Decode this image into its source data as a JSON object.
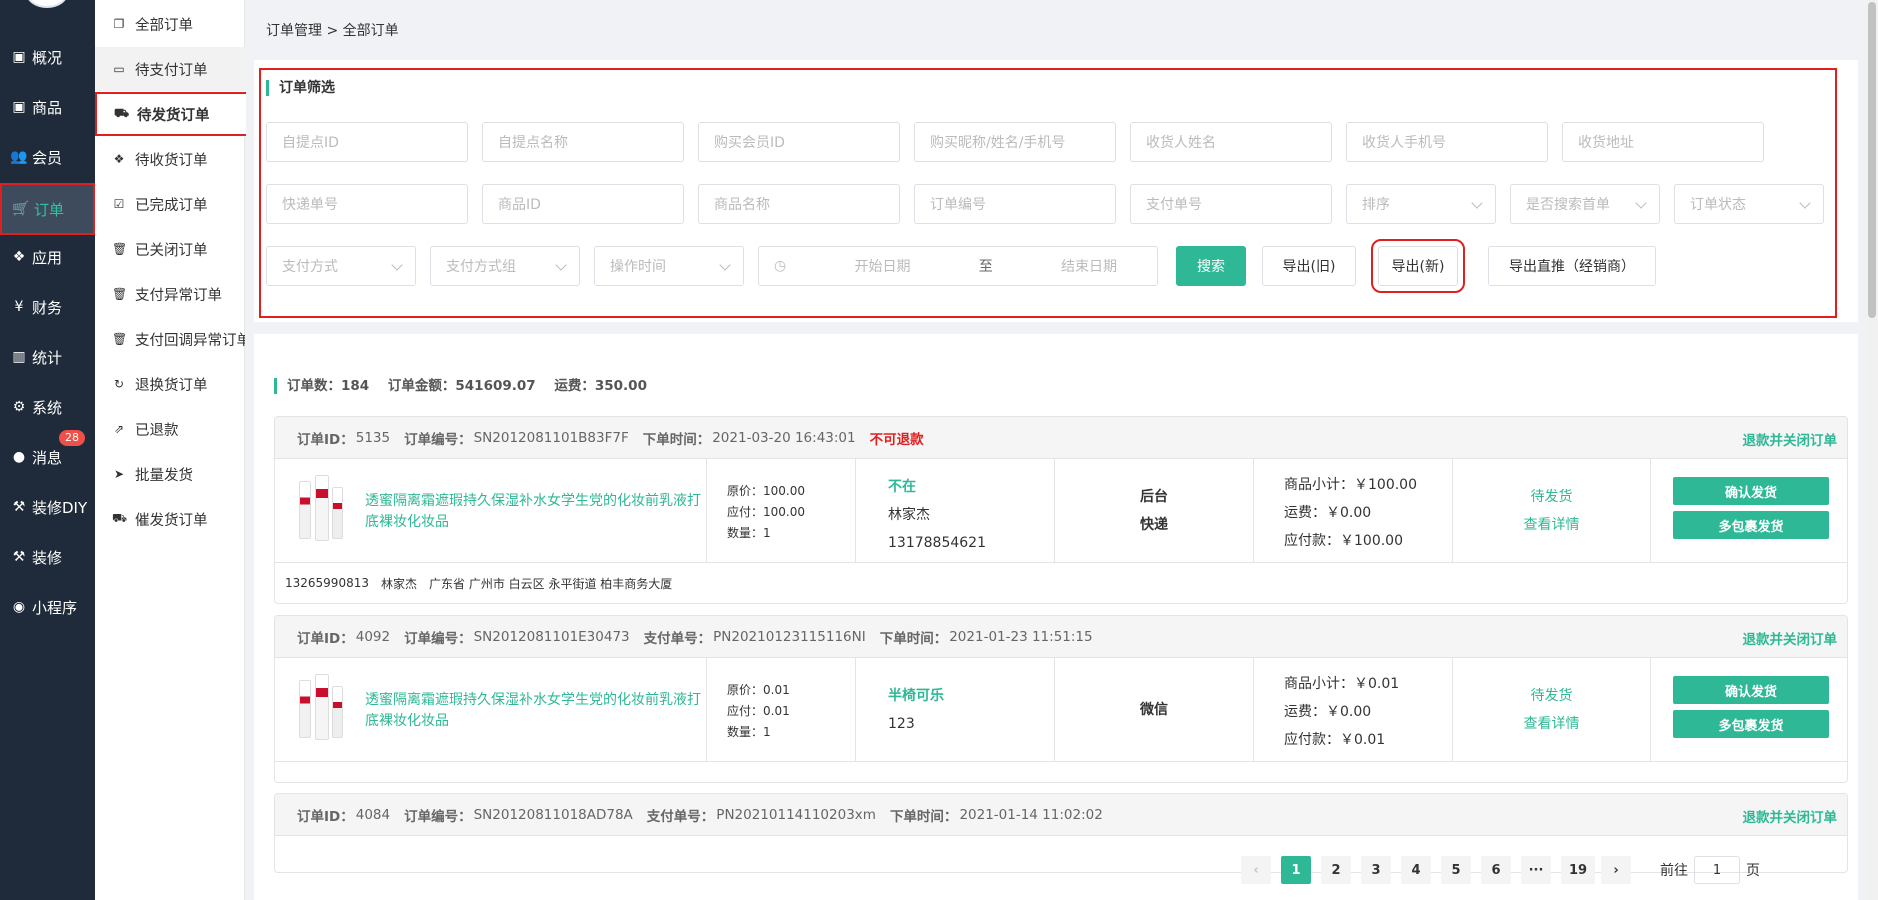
{
  "nav": {
    "items": [
      {
        "icon": "overview-icon",
        "glyph": "▣",
        "label": "概况"
      },
      {
        "icon": "goods-icon",
        "glyph": "▣",
        "label": "商品"
      },
      {
        "icon": "members-icon",
        "glyph": "👥",
        "label": "会员"
      },
      {
        "icon": "cart-icon",
        "glyph": "🛒",
        "label": "订单"
      },
      {
        "icon": "apps-icon",
        "glyph": "❖",
        "label": "应用"
      },
      {
        "icon": "yen-icon",
        "glyph": "¥",
        "label": "财务"
      },
      {
        "icon": "chart-icon",
        "glyph": "▥",
        "label": "统计"
      },
      {
        "icon": "gears-icon",
        "glyph": "⚙",
        "label": "系统"
      },
      {
        "icon": "message-icon",
        "glyph": "●",
        "label": "消息",
        "badge": "28"
      },
      {
        "icon": "hammer-icon",
        "glyph": "⚒",
        "label": "装修DIY"
      },
      {
        "icon": "hammer-icon",
        "glyph": "⚒",
        "label": "装修"
      },
      {
        "icon": "wechat-icon",
        "glyph": "◉",
        "label": "小程序"
      }
    ]
  },
  "subnav": {
    "items": [
      {
        "icon": "copy-icon",
        "glyph": "❐",
        "label": "全部订单"
      },
      {
        "icon": "card-icon",
        "glyph": "▭",
        "label": "待支付订单"
      },
      {
        "icon": "truck-icon",
        "glyph": "⛟",
        "label": "待发货订单"
      },
      {
        "icon": "dropbox-icon",
        "glyph": "❖",
        "label": "待收货订单"
      },
      {
        "icon": "check-square-icon",
        "glyph": "☑",
        "label": "已完成订单"
      },
      {
        "icon": "trash-icon",
        "glyph": "🗑",
        "label": "已关闭订单"
      },
      {
        "icon": "trash-icon",
        "glyph": "🗑",
        "label": "支付异常订单"
      },
      {
        "icon": "trash-icon",
        "glyph": "🗑",
        "label": "支付回调异常订单"
      },
      {
        "icon": "refresh-icon",
        "glyph": "↻",
        "label": "退换货订单"
      },
      {
        "icon": "share-icon",
        "glyph": "⇗",
        "label": "已退款"
      },
      {
        "icon": "paper-plane-icon",
        "glyph": "➤",
        "label": "批量发货"
      },
      {
        "icon": "truck-icon",
        "glyph": "⛟",
        "label": "催发货订单"
      }
    ]
  },
  "breadcrumb": "订单管理 > 全部订单",
  "filter": {
    "title": "订单筛选",
    "row1": [
      "自提点ID",
      "自提点名称",
      "购买会员ID",
      "购买昵称/姓名/手机号",
      "收货人姓名",
      "收货人手机号",
      "收货地址"
    ],
    "row2_inputs": [
      "快递单号",
      "商品ID",
      "商品名称",
      "订单编号",
      "支付单号"
    ],
    "row2_selects": [
      "排序",
      "是否搜索首单",
      "订单状态"
    ],
    "row3_selects": [
      "支付方式",
      "支付方式组",
      "操作时间"
    ],
    "date_start": "开始日期",
    "date_sep": "至",
    "date_end": "结束日期",
    "btn_search": "搜索",
    "btn_export_old": "导出(旧)",
    "btn_export_new": "导出(新)",
    "btn_export_direct": "导出直推（经销商）"
  },
  "summary": {
    "count_label": "订单数：",
    "count": "184",
    "amount_label": "订单金额：",
    "amount": "541609.07",
    "freight_label": "运费：",
    "freight": "350.00"
  },
  "orders": [
    {
      "id_label": "订单ID：",
      "id": "5135",
      "sn_label": "订单编号：",
      "sn": "SN2012081101B83F7F",
      "pay_label": "",
      "pay_sn": "",
      "time_label": "下单时间：",
      "time": "2021-03-20 16:43:01",
      "warn": "不可退款",
      "close": "退款并关闭订单",
      "product": "透蜜隔离霜遮瑕持久保湿补水女学生党的化妆前乳液打底裸妆化妆品",
      "orig_price": "原价：100.00",
      "pay_price": "应付：100.00",
      "qty": "数量：1",
      "buyer_nick": "不在",
      "buyer_name": "林家杰",
      "buyer_phone": "13178854621",
      "ship1": "后台",
      "ship2": "快递",
      "subtotal": "商品小计：￥100.00",
      "freight": "运费：￥0.00",
      "payable": "应付款：￥100.00",
      "status": "待发货",
      "detail": "查看详情",
      "btn_ship": "确认发货",
      "btn_multi": "多包裹发货",
      "addr_phone": "13265990813",
      "addr_name": "林家杰",
      "addr": "广东省 广州市 白云区 永平街道 柏丰商务大厦"
    },
    {
      "id_label": "订单ID：",
      "id": "4092",
      "sn_label": "订单编号：",
      "sn": "SN2012081101E30473",
      "pay_label": "支付单号：",
      "pay_sn": "PN20210123115116NI",
      "time_label": "下单时间：",
      "time": "2021-01-23 11:51:15",
      "warn": "",
      "close": "退款并关闭订单",
      "product": "透蜜隔离霜遮瑕持久保湿补水女学生党的化妆前乳液打底裸妆化妆品",
      "orig_price": "原价：0.01",
      "pay_price": "应付：0.01",
      "qty": "数量：1",
      "buyer_nick": "半椅可乐",
      "buyer_name": "123",
      "buyer_phone": "",
      "ship1": "微信",
      "ship2": "",
      "subtotal": "商品小计：￥0.01",
      "freight": "运费：￥0.00",
      "payable": "应付款：￥0.01",
      "status": "待发货",
      "detail": "查看详情",
      "btn_ship": "确认发货",
      "btn_multi": "多包裹发货",
      "addr_phone": "",
      "addr_name": "",
      "addr": ""
    },
    {
      "id_label": "订单ID：",
      "id": "4084",
      "sn_label": "订单编号：",
      "sn": "SN20120811018AD78A",
      "pay_label": "支付单号：",
      "pay_sn": "PN20210114110203xm",
      "time_label": "下单时间：",
      "time": "2021-01-14 11:02:02",
      "close": "退款并关闭订单"
    }
  ],
  "pagination": {
    "prev": "‹",
    "pages": [
      "1",
      "2",
      "3",
      "4",
      "5",
      "6",
      "···",
      "19"
    ],
    "next": "›",
    "goto_label": "前往",
    "goto_value": "1",
    "page_unit": "页"
  },
  "colors": {
    "accent": "#2fb896",
    "nav_bg": "#1f2b3a",
    "highlight_border": "#e02020"
  }
}
